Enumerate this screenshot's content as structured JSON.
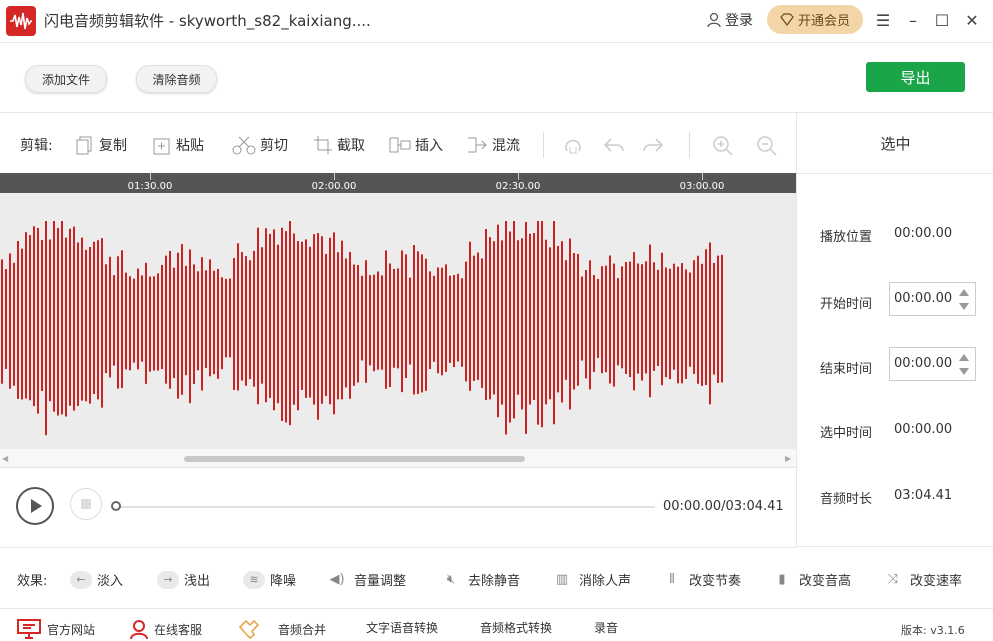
{
  "titlebar": {
    "title": "闪电音频剪辑软件 - skyworth_s82_kaixiang....",
    "login": "登录",
    "vip": "开通会员",
    "colors": {
      "logo": "#d62727",
      "vip_bg": "#f2d6a8"
    }
  },
  "toolbar": {
    "add_file": "添加文件",
    "clear_audio": "清除音频",
    "export": "导出",
    "export_color": "#1aa548"
  },
  "edit": {
    "label": "剪辑:",
    "tools": {
      "copy": "复制",
      "paste": "粘贴",
      "cut": "剪切",
      "crop": "截取",
      "insert": "插入",
      "mix": "混流"
    }
  },
  "timeline": {
    "ticks": [
      "01:30.00",
      "02:00.00",
      "02:30.00",
      "03:00.00"
    ]
  },
  "waveform": {
    "color": "#cc2222"
  },
  "playback": {
    "time": "00:00.00/03:04.41",
    "progress": 0
  },
  "selection": {
    "header": "选中",
    "play_position_label": "播放位置",
    "play_position": "00:00.00",
    "start_label": "开始时间",
    "start": "00:00.00",
    "end_label": "结束时间",
    "end": "00:00.00",
    "selected_label": "选中时间",
    "selected": "00:00.00",
    "duration_label": "音频时长",
    "duration": "03:04.41"
  },
  "effects": {
    "label": "效果:",
    "items": [
      "淡入",
      "浅出",
      "降噪",
      "音量调整",
      "去除静音",
      "消除人声",
      "改变节奏",
      "改变音高",
      "改变速率"
    ]
  },
  "footer": {
    "website": "官方网站",
    "support": "在线客服",
    "merge": "音频合并",
    "tts": "文字语音转换",
    "convert": "音频格式转换",
    "record": "录音",
    "version": "版本: v3.1.6"
  }
}
